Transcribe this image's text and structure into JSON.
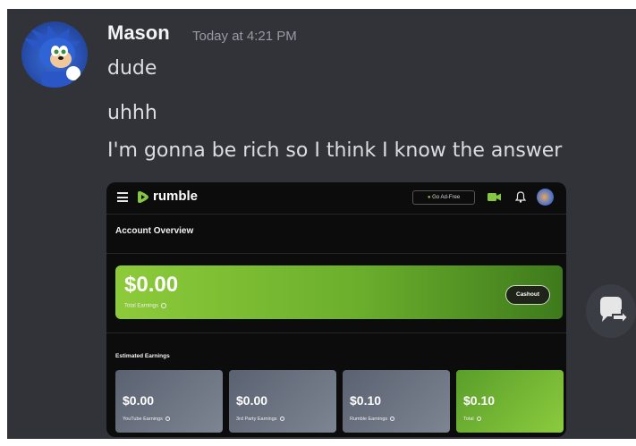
{
  "message": {
    "username": "Mason",
    "timestamp": "Today at 4:21 PM",
    "lines": [
      "dude",
      "uhhh",
      "I'm gonna be rich so I think I know the answer"
    ]
  },
  "embed": {
    "brand": "rumble",
    "go_ad_free": "Go Ad-Free",
    "account_overview": "Account Overview",
    "total": {
      "amount": "$0.00",
      "label": "Total Earnings",
      "cashout_label": "Cashout"
    },
    "estimated_title": "Estimated Earnings",
    "earnings": [
      {
        "amount": "$0.00",
        "label": "YouTube Earnings"
      },
      {
        "amount": "$0.00",
        "label": "3rd Party Earnings"
      },
      {
        "amount": "$0.10",
        "label": "Rumble Earnings"
      },
      {
        "amount": "$0.10",
        "label": "Total"
      }
    ]
  },
  "colors": {
    "background": "#313338",
    "rumble_green": "#85c742",
    "username": "#f2f3f5",
    "timestamp": "#949ba4"
  },
  "icons": {
    "avatar": "sonic-avatar",
    "menu": "hamburger-icon",
    "upload": "video-upload-icon",
    "bell": "bell-icon",
    "reply": "reply-icon"
  }
}
